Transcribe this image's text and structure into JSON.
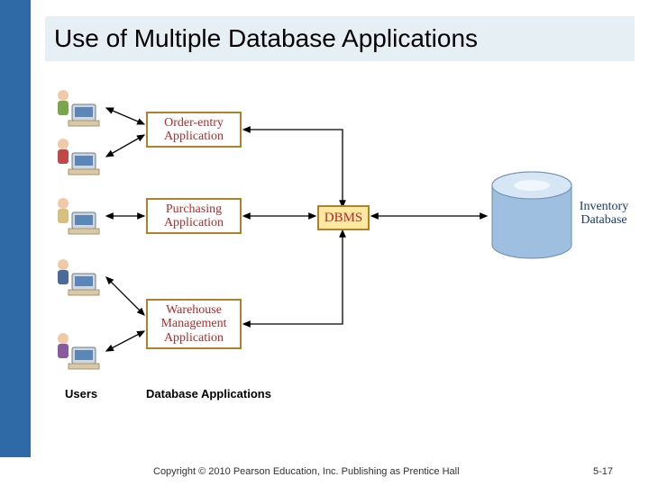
{
  "title": "Use of Multiple Database Applications",
  "apps": {
    "order": "Order-entry\nApplication",
    "purchasing": "Purchasing\nApplication",
    "warehouse": "Warehouse\nManagement\nApplication"
  },
  "dbms": "DBMS",
  "database": "Inventory\nDatabase",
  "columns": {
    "users": "Users",
    "apps": "Database Applications"
  },
  "copyright": "Copyright © 2010 Pearson Education, Inc. Publishing as Prentice Hall",
  "page": "5-17"
}
